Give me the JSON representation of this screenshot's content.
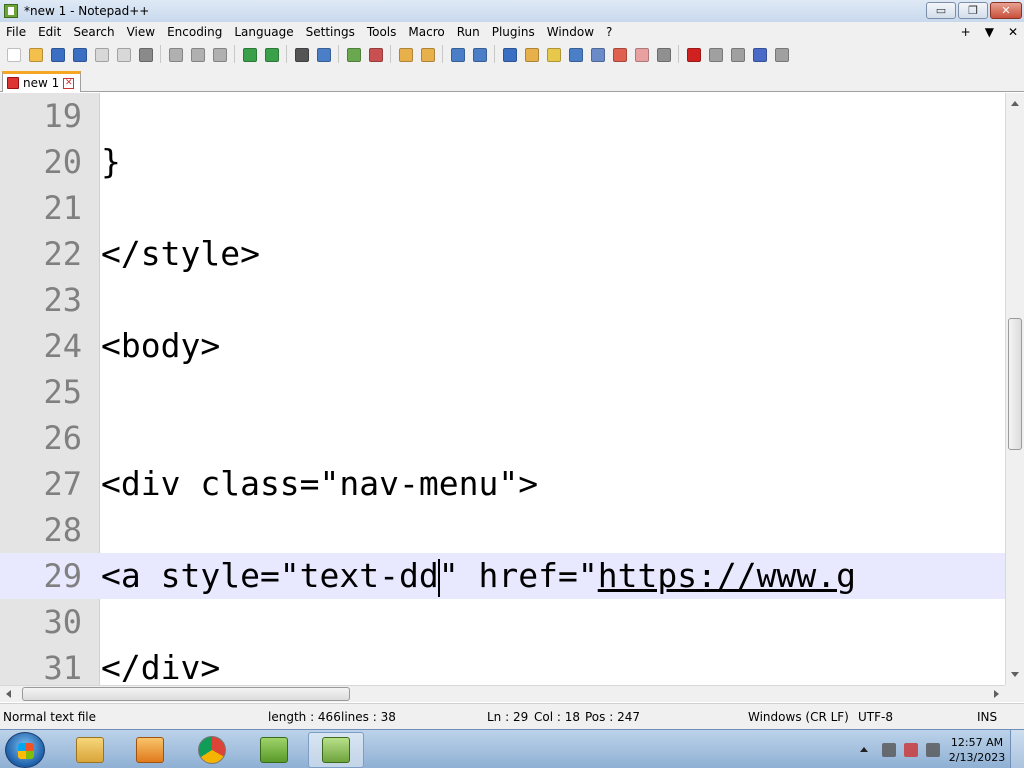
{
  "window": {
    "title": "*new 1 - Notepad++",
    "minimize_label": "▭",
    "maximize_label": "❐",
    "close_label": "✕"
  },
  "menu": {
    "items": [
      "File",
      "Edit",
      "Search",
      "View",
      "Encoding",
      "Language",
      "Settings",
      "Tools",
      "Macro",
      "Run",
      "Plugins",
      "Window",
      "?"
    ],
    "right": [
      "+",
      "▼",
      "✕"
    ]
  },
  "tab": {
    "label": "new 1",
    "close_label": "✕"
  },
  "editor": {
    "lines": [
      {
        "num": "19",
        "code": ""
      },
      {
        "num": "20",
        "code": "}"
      },
      {
        "num": "21",
        "code": ""
      },
      {
        "num": "22",
        "code": "</style>"
      },
      {
        "num": "23",
        "code": ""
      },
      {
        "num": "24",
        "code": "<body>"
      },
      {
        "num": "25",
        "code": ""
      },
      {
        "num": "26",
        "code": ""
      },
      {
        "num": "27",
        "code": "<div class=\"nav-menu\">"
      },
      {
        "num": "28",
        "code": ""
      },
      {
        "num": "29",
        "code_before_caret": "<a style=\"text-dd",
        "code_after_caret": "\" href=\"",
        "url": "https://www.g"
      },
      {
        "num": "30",
        "code": ""
      },
      {
        "num": "31",
        "code": "</div>"
      }
    ]
  },
  "status": {
    "file_type": "Normal text file",
    "length": "length : 466",
    "lines": "lines : 38",
    "ln": "Ln : 29",
    "col": "Col : 18",
    "pos": "Pos : 247",
    "eol": "Windows (CR LF)",
    "encoding": "UTF-8",
    "mode": "INS"
  },
  "taskbar": {
    "time": "12:57 AM",
    "date": "2/13/2023"
  }
}
